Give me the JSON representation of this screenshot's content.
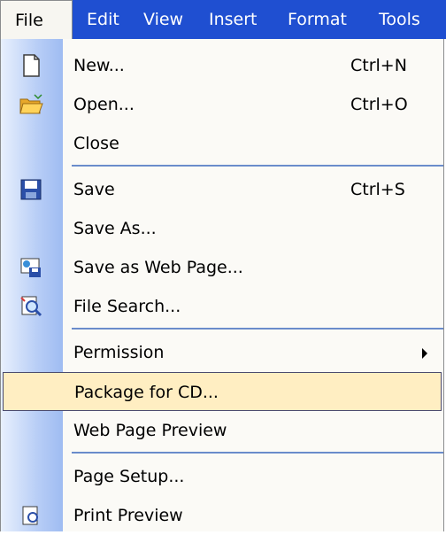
{
  "menubar": {
    "items": [
      {
        "label": "File"
      },
      {
        "label": "Edit"
      },
      {
        "label": "View"
      },
      {
        "label": "Insert"
      },
      {
        "label": "Format"
      },
      {
        "label": "Tools"
      }
    ]
  },
  "file_menu": {
    "items": [
      {
        "label": "New...",
        "shortcut": "Ctrl+N",
        "icon": "new-document-icon"
      },
      {
        "label": "Open...",
        "shortcut": "Ctrl+O",
        "icon": "open-folder-icon"
      },
      {
        "label": "Close"
      },
      {
        "label": "Save",
        "shortcut": "Ctrl+S",
        "icon": "save-floppy-icon"
      },
      {
        "label": "Save As..."
      },
      {
        "label": "Save as Web Page...",
        "icon": "web-page-icon"
      },
      {
        "label": "File Search...",
        "icon": "file-search-icon"
      },
      {
        "label": "Permission",
        "has_submenu": true
      },
      {
        "label": "Package for CD...",
        "highlighted": true
      },
      {
        "label": "Web Page Preview"
      },
      {
        "label": "Page Setup..."
      },
      {
        "label": "Print Preview",
        "icon": "print-preview-icon"
      }
    ]
  },
  "colors": {
    "menubar_bg": "#1f4fd1",
    "highlight_bg": "#ffeec2",
    "separator": "#6a8ccb"
  }
}
